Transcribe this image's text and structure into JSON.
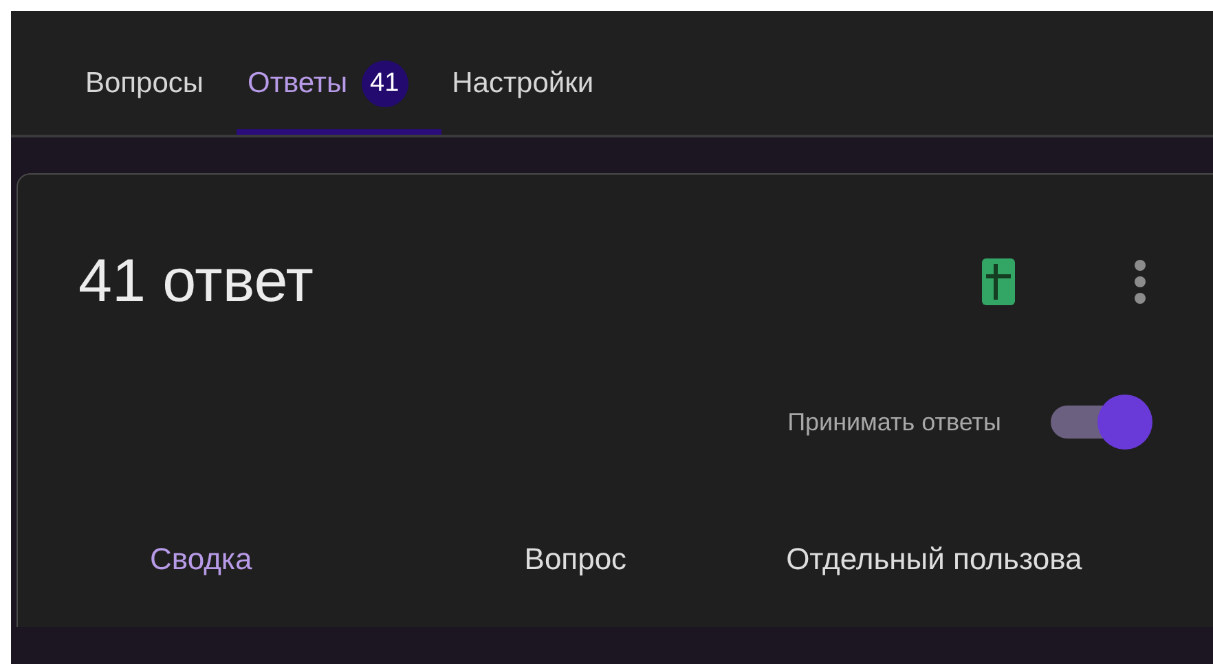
{
  "tabs": [
    {
      "label": "Вопросы",
      "selected": false
    },
    {
      "label": "Ответы",
      "selected": true,
      "badge": "41"
    },
    {
      "label": "Настройки",
      "selected": false
    }
  ],
  "summary": {
    "title": "41 ответ",
    "accepting_label": "Принимать ответы",
    "accepting": true
  },
  "view_tabs": [
    {
      "label": "Сводка",
      "selected": true
    },
    {
      "label": "Вопрос",
      "selected": false
    },
    {
      "label": "Отдельный пользова",
      "selected": false
    }
  ]
}
